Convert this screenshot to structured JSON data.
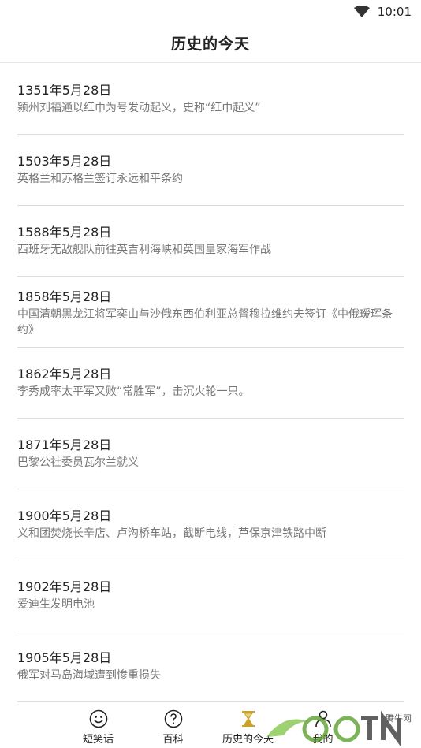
{
  "status_bar": {
    "time": "10:01"
  },
  "header": {
    "title": "历史的今天"
  },
  "events": [
    {
      "date": "1351年5月28日",
      "desc": "颍州刘福通以红巾为号发动起义，史称“红巾起义”"
    },
    {
      "date": "1503年5月28日",
      "desc": "英格兰和苏格兰签订永远和平条约"
    },
    {
      "date": "1588年5月28日",
      "desc": "西班牙无敌舰队前往英吉利海峡和英国皇家海军作战"
    },
    {
      "date": "1858年5月28日",
      "desc": "中国清朝黑龙江将军奕山与沙俄东西伯利亚总督穆拉维约夫签订《中俄瑷珲条约》"
    },
    {
      "date": "1862年5月28日",
      "desc": "李秀成率太平军又败“常胜军”，击沉火轮一只。"
    },
    {
      "date": "1871年5月28日",
      "desc": "巴黎公社委员瓦尔兰就义"
    },
    {
      "date": "1900年5月28日",
      "desc": "义和团焚烧长辛店、卢沟桥车站，截断电线，芦保京津铁路中断"
    },
    {
      "date": "1902年5月28日",
      "desc": "爱迪生发明电池"
    },
    {
      "date": "1905年5月28日",
      "desc": "俄军对马岛海域遭到惨重损失"
    }
  ],
  "nav": {
    "items": [
      {
        "label": "短笑话",
        "icon": "smiley-icon"
      },
      {
        "label": "百科",
        "icon": "question-icon"
      },
      {
        "label": "历史的今天",
        "icon": "hourglass-icon"
      },
      {
        "label": "我的",
        "icon": "person-icon"
      }
    ],
    "active_index": 2
  },
  "watermark": {
    "small_text": "腾牛网"
  },
  "colors": {
    "accent_gold": "#c9a227",
    "divider": "#dcdcdc",
    "watermark_green": "#7cc241"
  }
}
